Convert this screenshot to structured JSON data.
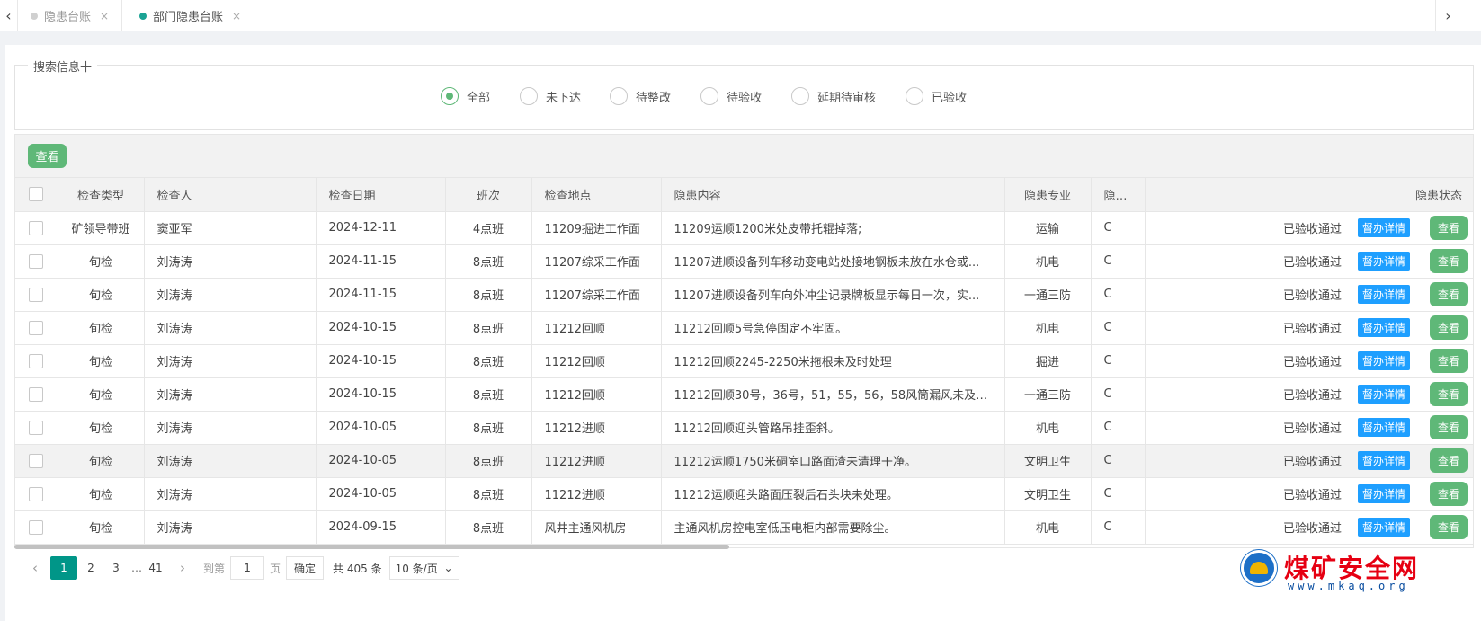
{
  "tabs": [
    {
      "label": "隐患台账",
      "active": false
    },
    {
      "label": "部门隐患台账",
      "active": true
    }
  ],
  "tab_close_glyph": "×",
  "search": {
    "legend": "搜索信息十",
    "radios": [
      {
        "label": "全部",
        "checked": true
      },
      {
        "label": "未下达",
        "checked": false
      },
      {
        "label": "待整改",
        "checked": false
      },
      {
        "label": "待验收",
        "checked": false
      },
      {
        "label": "延期待审核",
        "checked": false
      },
      {
        "label": "已验收",
        "checked": false
      }
    ]
  },
  "toolbar": {
    "view_label": "查看"
  },
  "table": {
    "headers": [
      "检查类型",
      "检查人",
      "检查日期",
      "班次",
      "检查地点",
      "隐患内容",
      "隐患专业",
      "隐患等",
      "隐患状态"
    ],
    "rows": [
      [
        "矿领导带班",
        "窦亚军",
        "2024-12-11",
        "4点班",
        "11209掘进工作面",
        "11209运顺1200米处皮带托辊掉落;",
        "运输",
        "C",
        "已验收通过"
      ],
      [
        "旬检",
        "刘涛涛",
        "2024-11-15",
        "8点班",
        "11207综采工作面",
        "11207进顺设备列车移动变电站处接地钢板未放在水仓或...",
        "机电",
        "C",
        "已验收通过"
      ],
      [
        "旬检",
        "刘涛涛",
        "2024-11-15",
        "8点班",
        "11207综采工作面",
        "11207进顺设备列车向外冲尘记录牌板显示每日一次，实...",
        "一通三防",
        "C",
        "已验收通过"
      ],
      [
        "旬检",
        "刘涛涛",
        "2024-10-15",
        "8点班",
        "11212回顺",
        "11212回顺5号急停固定不牢固。",
        "机电",
        "C",
        "已验收通过"
      ],
      [
        "旬检",
        "刘涛涛",
        "2024-10-15",
        "8点班",
        "11212回顺",
        "11212回顺2245-2250米拖根未及时处理",
        "掘进",
        "C",
        "已验收通过"
      ],
      [
        "旬检",
        "刘涛涛",
        "2024-10-15",
        "8点班",
        "11212回顺",
        "11212回顺30号，36号，51，55，56，58风筒漏风未及时...",
        "一通三防",
        "C",
        "已验收通过"
      ],
      [
        "旬检",
        "刘涛涛",
        "2024-10-05",
        "8点班",
        "11212进顺",
        "11212回顺迎头管路吊挂歪斜。",
        "机电",
        "C",
        "已验收通过"
      ],
      [
        "旬检",
        "刘涛涛",
        "2024-10-05",
        "8点班",
        "11212进顺",
        "11212运顺1750米硐室口路面渣未清理干净。",
        "文明卫生",
        "C",
        "已验收通过"
      ],
      [
        "旬检",
        "刘涛涛",
        "2024-10-05",
        "8点班",
        "11212进顺",
        "11212运顺迎头路面压裂后石头块未处理。",
        "文明卫生",
        "C",
        "已验收通过"
      ],
      [
        "旬检",
        "刘涛涛",
        "2024-09-15",
        "8点班",
        "风井主通风机房",
        "主通风机房控电室低压电柜内部需要除尘。",
        "机电",
        "C",
        "已验收通过"
      ]
    ],
    "detail_label": "督办详情",
    "view_label": "查看"
  },
  "pager": {
    "pages": [
      "1",
      "2",
      "3"
    ],
    "ellipsis": "…",
    "last_page": "41",
    "goto_label": "到第",
    "goto_value": "1",
    "page_unit": "页",
    "confirm_label": "确定",
    "total_text": "共 405 条",
    "page_size": "10 条/页",
    "prev_glyph": "‹",
    "next_glyph": "›"
  },
  "watermark": {
    "brand": "煤矿安全网",
    "url": "www.mkaq.org"
  },
  "colors": {
    "accent_green": "#5fb878",
    "active_page": "#009688",
    "info_blue": "#1e9fff",
    "brand_red": "#e60012"
  }
}
